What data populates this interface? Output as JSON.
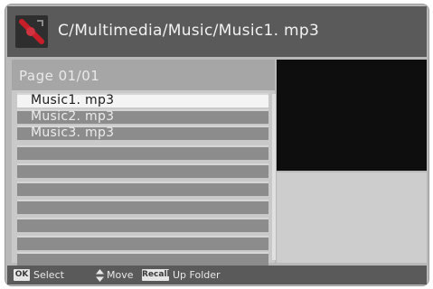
{
  "header": {
    "path": "C/Multimedia/Music/Music1. mp3",
    "icon": "music-folder-icon"
  },
  "list": {
    "page_label": "Page 01/01",
    "items": [
      {
        "label": "Music1. mp3",
        "selected": true
      },
      {
        "label": "Music2. mp3",
        "selected": false
      },
      {
        "label": "Music3. mp3",
        "selected": false
      },
      {
        "label": "",
        "selected": false
      },
      {
        "label": "",
        "selected": false
      },
      {
        "label": "",
        "selected": false
      },
      {
        "label": "",
        "selected": false
      },
      {
        "label": "",
        "selected": false
      },
      {
        "label": "",
        "selected": false
      },
      {
        "label": "",
        "selected": false
      }
    ]
  },
  "footer": {
    "ok_key": "OK",
    "select_label": "Select",
    "move_label": "Move",
    "recall_key": "Recall",
    "up_folder_label": "Up Folder"
  },
  "colors": {
    "header_bg": "#5a5a5a",
    "selected_row": "#f4f4f4",
    "row_bg": "#8c8c8c",
    "preview_bg": "#0e0e0e"
  }
}
